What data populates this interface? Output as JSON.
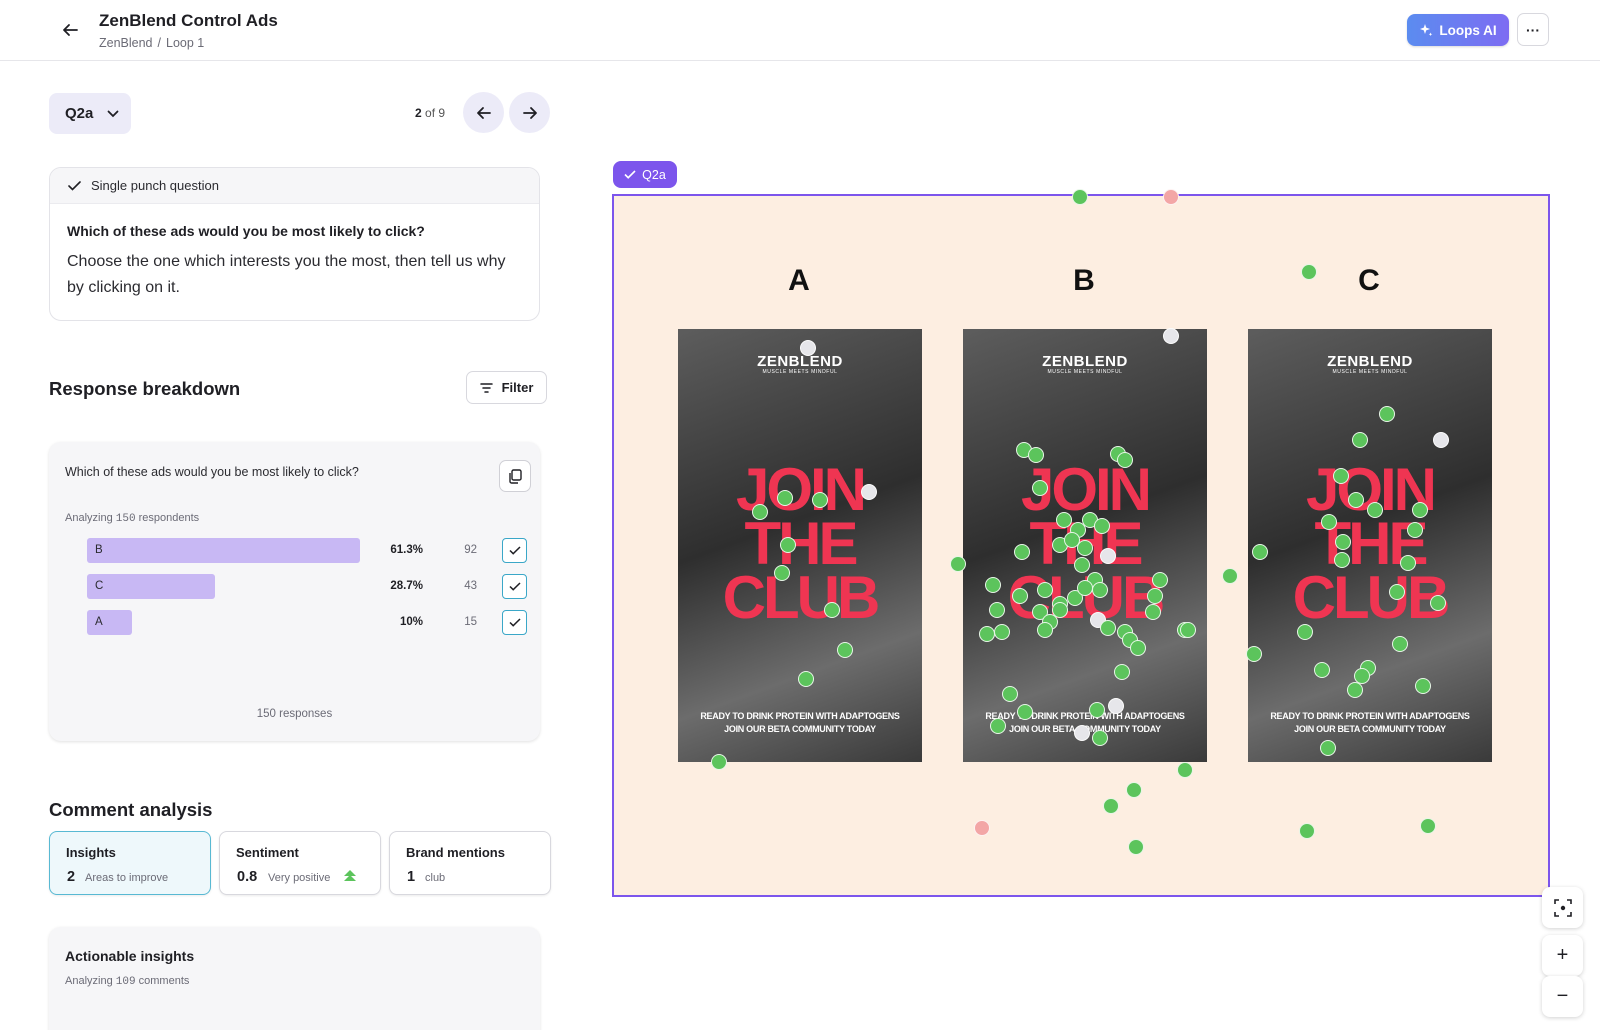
{
  "header": {
    "title": "ZenBlend Control Ads",
    "breadcrumb": [
      "ZenBlend",
      "/",
      "Loop 1"
    ],
    "loops_ai_label": "Loops AI",
    "more_label": "···"
  },
  "question_nav": {
    "selected": "Q2a",
    "page_current": "2",
    "page_suffix": "of 9"
  },
  "question_card": {
    "type_label": "Single punch question",
    "question": "Which of these ads would you be most likely to click?",
    "instruction": "Choose the one which interests you the most, then tell us why by clicking on it."
  },
  "response_breakdown": {
    "title": "Response breakdown",
    "filter_label": "Filter",
    "question": "Which of these ads would you be most likely to click?",
    "analyzing_prefix": "Analyzing",
    "respondents": "150",
    "analyzing_suffix": "respondents",
    "rows": [
      {
        "label": "B",
        "percent": "61.3%",
        "count": "92",
        "value": 61.3
      },
      {
        "label": "C",
        "percent": "28.7%",
        "count": "43",
        "value": 28.7
      },
      {
        "label": "A",
        "percent": "10%",
        "count": "15",
        "value": 10
      }
    ],
    "total_responses": "150 responses"
  },
  "comment_analysis": {
    "title": "Comment analysis",
    "cards": [
      {
        "title": "Insights",
        "value": "2",
        "sub": "Areas to improve"
      },
      {
        "title": "Sentiment",
        "value": "0.8",
        "sub": "Very positive"
      },
      {
        "title": "Brand mentions",
        "value": "1",
        "sub": "club"
      }
    ]
  },
  "actionable": {
    "title": "Actionable insights",
    "analyzing_prefix": "Analyzing",
    "comments": "109",
    "analyzing_suffix": "comments"
  },
  "canvas": {
    "tag": "Q2a",
    "ads": [
      {
        "letter": "A",
        "logo": "ZENBLEND",
        "logo_sub": "MUSCLE MEETS MINDFUL",
        "headline": "JOIN THE CLUB",
        "footer_1": "READY TO DRINK PROTEIN WITH ADAPTOGENS",
        "footer_2": "JOIN OUR BETA COMMUNITY TODAY"
      },
      {
        "letter": "B",
        "logo": "ZENBLEND",
        "logo_sub": "MUSCLE MEETS MINDFUL",
        "headline": "JOIN THE CLUB",
        "footer_1": "READY TO DRINK PROTEIN WITH ADAPTOGENS",
        "footer_2": "JOIN OUR BETA COMMUNITY TODAY"
      },
      {
        "letter": "C",
        "logo": "ZENBLEND",
        "logo_sub": "MUSCLE MEETS MINDFUL",
        "headline": "JOIN THE CLUB",
        "footer_1": "READY TO DRINK PROTEIN WITH ADAPTOGENS",
        "footer_2": "JOIN OUR BETA COMMUNITY TODAY"
      }
    ]
  },
  "zoom": {
    "in_label": "+",
    "out_label": "−"
  },
  "colors": {
    "accent": "#7c55ec",
    "bar": "#c8b8f4",
    "positive_click": "#5cc45c",
    "negative_click": "#f3a6a6",
    "neutral_click": "#e6e6ea",
    "headline": "#ef3552"
  }
}
